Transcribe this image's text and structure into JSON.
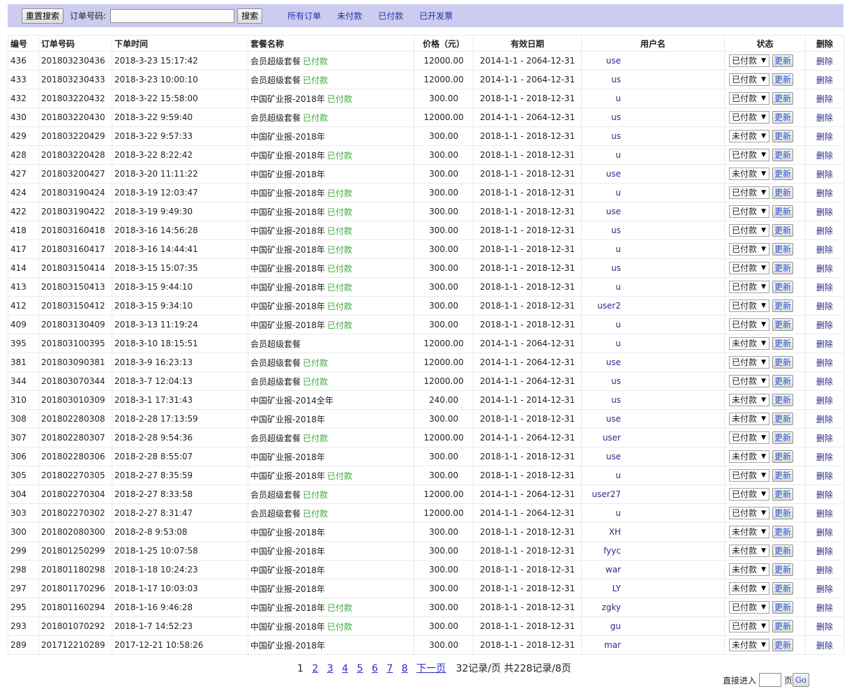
{
  "toolbar": {
    "reset_label": "重置搜索",
    "order_label": "订单号码:",
    "order_value": "",
    "search_label": "搜索",
    "links": [
      "所有订单",
      "未付款",
      "已付款",
      "已开发票"
    ]
  },
  "table": {
    "headers": [
      "编号",
      "订单号码",
      "下单时间",
      "套餐名称",
      "价格（元）",
      "有效日期",
      "用户名",
      "状态",
      "删除"
    ],
    "update_label": "更新",
    "delete_label": "删除",
    "rows": [
      {
        "id": "436",
        "order": "201803230436",
        "time": "2018-3-23 15:17:42",
        "pkg": "会员超级套餐",
        "paid_tag": "已付款",
        "price": "12000.00",
        "valid": "2014-1-1 - 2064-12-31",
        "user": "use",
        "status": "已付款"
      },
      {
        "id": "433",
        "order": "201803230433",
        "time": "2018-3-23 10:00:10",
        "pkg": "会员超级套餐",
        "paid_tag": "已付款",
        "price": "12000.00",
        "valid": "2014-1-1 - 2064-12-31",
        "user": "us",
        "status": "已付款"
      },
      {
        "id": "432",
        "order": "201803220432",
        "time": "2018-3-22 15:58:00",
        "pkg": "中国矿业报-2018年",
        "paid_tag": "已付款",
        "price": "300.00",
        "valid": "2018-1-1 - 2018-12-31",
        "user": "u",
        "status": "已付款"
      },
      {
        "id": "430",
        "order": "201803220430",
        "time": "2018-3-22 9:59:40",
        "pkg": "会员超级套餐",
        "paid_tag": "已付款",
        "price": "12000.00",
        "valid": "2014-1-1 - 2064-12-31",
        "user": "us",
        "status": "已付款"
      },
      {
        "id": "429",
        "order": "201803220429",
        "time": "2018-3-22 9:57:33",
        "pkg": "中国矿业报-2018年",
        "paid_tag": "",
        "price": "300.00",
        "valid": "2018-1-1 - 2018-12-31",
        "user": "us",
        "status": "未付款"
      },
      {
        "id": "428",
        "order": "201803220428",
        "time": "2018-3-22 8:22:42",
        "pkg": "中国矿业报-2018年",
        "paid_tag": "已付款",
        "price": "300.00",
        "valid": "2018-1-1 - 2018-12-31",
        "user": "u",
        "status": "已付款"
      },
      {
        "id": "427",
        "order": "201803200427",
        "time": "2018-3-20 11:11:22",
        "pkg": "中国矿业报-2018年",
        "paid_tag": "",
        "price": "300.00",
        "valid": "2018-1-1 - 2018-12-31",
        "user": "use",
        "status": "未付款"
      },
      {
        "id": "424",
        "order": "201803190424",
        "time": "2018-3-19 12:03:47",
        "pkg": "中国矿业报-2018年",
        "paid_tag": "已付款",
        "price": "300.00",
        "valid": "2018-1-1 - 2018-12-31",
        "user": "u",
        "status": "已付款"
      },
      {
        "id": "422",
        "order": "201803190422",
        "time": "2018-3-19 9:49:30",
        "pkg": "中国矿业报-2018年",
        "paid_tag": "已付款",
        "price": "300.00",
        "valid": "2018-1-1 - 2018-12-31",
        "user": "use",
        "status": "已付款"
      },
      {
        "id": "418",
        "order": "201803160418",
        "time": "2018-3-16 14:56:28",
        "pkg": "中国矿业报-2018年",
        "paid_tag": "已付款",
        "price": "300.00",
        "valid": "2018-1-1 - 2018-12-31",
        "user": "us",
        "status": "已付款"
      },
      {
        "id": "417",
        "order": "201803160417",
        "time": "2018-3-16 14:44:41",
        "pkg": "中国矿业报-2018年",
        "paid_tag": "已付款",
        "price": "300.00",
        "valid": "2018-1-1 - 2018-12-31",
        "user": "u",
        "status": "已付款"
      },
      {
        "id": "414",
        "order": "201803150414",
        "time": "2018-3-15 15:07:35",
        "pkg": "中国矿业报-2018年",
        "paid_tag": "已付款",
        "price": "300.00",
        "valid": "2018-1-1 - 2018-12-31",
        "user": "us",
        "status": "已付款"
      },
      {
        "id": "413",
        "order": "201803150413",
        "time": "2018-3-15 9:44:10",
        "pkg": "中国矿业报-2018年",
        "paid_tag": "已付款",
        "price": "300.00",
        "valid": "2018-1-1 - 2018-12-31",
        "user": "u",
        "status": "已付款"
      },
      {
        "id": "412",
        "order": "201803150412",
        "time": "2018-3-15 9:34:10",
        "pkg": "中国矿业报-2018年",
        "paid_tag": "已付款",
        "price": "300.00",
        "valid": "2018-1-1 - 2018-12-31",
        "user": "user2",
        "status": "已付款"
      },
      {
        "id": "409",
        "order": "201803130409",
        "time": "2018-3-13 11:19:24",
        "pkg": "中国矿业报-2018年",
        "paid_tag": "已付款",
        "price": "300.00",
        "valid": "2018-1-1 - 2018-12-31",
        "user": "u",
        "status": "已付款"
      },
      {
        "id": "395",
        "order": "201803100395",
        "time": "2018-3-10 18:15:51",
        "pkg": "会员超级套餐",
        "paid_tag": "",
        "price": "12000.00",
        "valid": "2014-1-1 - 2064-12-31",
        "user": "u",
        "status": "未付款"
      },
      {
        "id": "381",
        "order": "201803090381",
        "time": "2018-3-9 16:23:13",
        "pkg": "会员超级套餐",
        "paid_tag": "已付款",
        "price": "12000.00",
        "valid": "2014-1-1 - 2064-12-31",
        "user": "use",
        "status": "已付款"
      },
      {
        "id": "344",
        "order": "201803070344",
        "time": "2018-3-7 12:04:13",
        "pkg": "会员超级套餐",
        "paid_tag": "已付款",
        "price": "12000.00",
        "valid": "2014-1-1 - 2064-12-31",
        "user": "us",
        "status": "已付款"
      },
      {
        "id": "310",
        "order": "201803010309",
        "time": "2018-3-1 17:31:43",
        "pkg": "中国矿业报-2014全年",
        "paid_tag": "",
        "price": "240.00",
        "valid": "2014-1-1 - 2014-12-31",
        "user": "us",
        "status": "未付款"
      },
      {
        "id": "308",
        "order": "201802280308",
        "time": "2018-2-28 17:13:59",
        "pkg": "中国矿业报-2018年",
        "paid_tag": "",
        "price": "300.00",
        "valid": "2018-1-1 - 2018-12-31",
        "user": "use",
        "status": "未付款"
      },
      {
        "id": "307",
        "order": "201802280307",
        "time": "2018-2-28 9:54:36",
        "pkg": "会员超级套餐",
        "paid_tag": "已付款",
        "price": "12000.00",
        "valid": "2014-1-1 - 2064-12-31",
        "user": "user",
        "status": "已付款"
      },
      {
        "id": "306",
        "order": "201802280306",
        "time": "2018-2-28 8:55:07",
        "pkg": "中国矿业报-2018年",
        "paid_tag": "",
        "price": "300.00",
        "valid": "2018-1-1 - 2018-12-31",
        "user": "use",
        "status": "未付款"
      },
      {
        "id": "305",
        "order": "201802270305",
        "time": "2018-2-27 8:35:59",
        "pkg": "中国矿业报-2018年",
        "paid_tag": "已付款",
        "price": "300.00",
        "valid": "2018-1-1 - 2018-12-31",
        "user": "u",
        "status": "已付款"
      },
      {
        "id": "304",
        "order": "201802270304",
        "time": "2018-2-27 8:33:58",
        "pkg": "会员超级套餐",
        "paid_tag": "已付款",
        "price": "12000.00",
        "valid": "2014-1-1 - 2064-12-31",
        "user": "user27",
        "status": "已付款"
      },
      {
        "id": "303",
        "order": "201802270302",
        "time": "2018-2-27 8:31:47",
        "pkg": "会员超级套餐",
        "paid_tag": "已付款",
        "price": "12000.00",
        "valid": "2014-1-1 - 2064-12-31",
        "user": "u",
        "status": "已付款"
      },
      {
        "id": "300",
        "order": "201802080300",
        "time": "2018-2-8 9:53:08",
        "pkg": "中国矿业报-2018年",
        "paid_tag": "",
        "price": "300.00",
        "valid": "2018-1-1 - 2018-12-31",
        "user": "XH",
        "status": "未付款"
      },
      {
        "id": "299",
        "order": "201801250299",
        "time": "2018-1-25 10:07:58",
        "pkg": "中国矿业报-2018年",
        "paid_tag": "",
        "price": "300.00",
        "valid": "2018-1-1 - 2018-12-31",
        "user": "fyyc",
        "status": "未付款"
      },
      {
        "id": "298",
        "order": "201801180298",
        "time": "2018-1-18 10:24:23",
        "pkg": "中国矿业报-2018年",
        "paid_tag": "",
        "price": "300.00",
        "valid": "2018-1-1 - 2018-12-31",
        "user": "war",
        "status": "未付款"
      },
      {
        "id": "297",
        "order": "201801170296",
        "time": "2018-1-17 10:03:03",
        "pkg": "中国矿业报-2018年",
        "paid_tag": "",
        "price": "300.00",
        "valid": "2018-1-1 - 2018-12-31",
        "user": "LY",
        "status": "未付款"
      },
      {
        "id": "295",
        "order": "201801160294",
        "time": "2018-1-16 9:46:28",
        "pkg": "中国矿业报-2018年",
        "paid_tag": "已付款",
        "price": "300.00",
        "valid": "2018-1-1 - 2018-12-31",
        "user": "zgky",
        "status": "已付款"
      },
      {
        "id": "293",
        "order": "201801070292",
        "time": "2018-1-7 14:52:23",
        "pkg": "中国矿业报-2018年",
        "paid_tag": "已付款",
        "price": "300.00",
        "valid": "2018-1-1 - 2018-12-31",
        "user": "gu",
        "status": "已付款"
      },
      {
        "id": "289",
        "order": "201712210289",
        "time": "2017-12-21 10:58:26",
        "pkg": "中国矿业报-2018年",
        "paid_tag": "",
        "price": "300.00",
        "valid": "2018-1-1 - 2018-12-31",
        "user": "mar",
        "status": "未付款"
      }
    ]
  },
  "pager": {
    "current": "1",
    "pages": [
      "2",
      "3",
      "4",
      "5",
      "6",
      "7",
      "8"
    ],
    "next_label": "下一页",
    "info": "32记录/页 共228记录/8页",
    "jump_label": "直接进入",
    "page_suffix": "页",
    "go_label": "Go"
  }
}
